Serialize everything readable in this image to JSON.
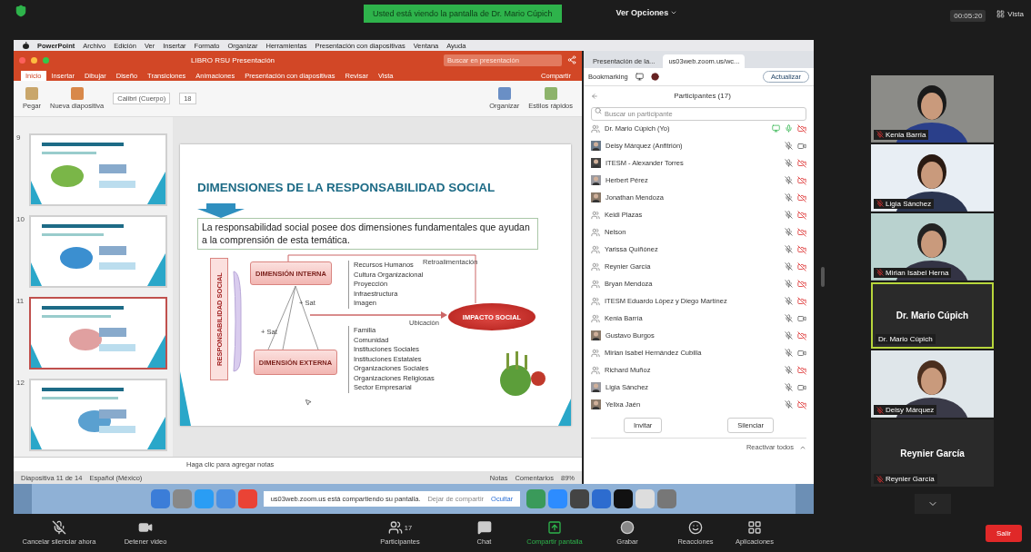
{
  "top_bar": {
    "banner": "Usted está viendo la pantalla de Dr. Mario Cúpich",
    "view_options": "Ver Opciones",
    "timer": "00:05:20",
    "view": "Vista"
  },
  "shared_screen": {
    "menubar": [
      "PowerPoint",
      "Archivo",
      "Edición",
      "Ver",
      "Insertar",
      "Formato",
      "Organizar",
      "Herramientas",
      "Presentación con diapositivas",
      "Ventana",
      "Ayuda"
    ],
    "powerpoint": {
      "title": "LIBRO RSU Presentación",
      "search": {
        "placeholder": "Buscar en presentación"
      },
      "tabs": [
        {
          "label": "Inicio",
          "selected": true
        },
        {
          "label": "Insertar",
          "selected": false
        },
        {
          "label": "Dibujar",
          "selected": false
        },
        {
          "label": "Diseño",
          "selected": false
        },
        {
          "label": "Transiciones",
          "selected": false
        },
        {
          "label": "Animaciones",
          "selected": false
        },
        {
          "label": "Presentación con diapositivas",
          "selected": false
        },
        {
          "label": "Revisar",
          "selected": false
        },
        {
          "label": "Vista",
          "selected": false
        }
      ],
      "share": "Compartir",
      "ribbon": {
        "font": "Calibri (Cuerpo)",
        "size": "18",
        "buttons": [
          "Pegar",
          "Nueva diapositiva",
          "Organizar",
          "Estilos rápidos"
        ]
      },
      "thumbnails": [
        {
          "number": "9",
          "selected": false
        },
        {
          "number": "10",
          "selected": false
        },
        {
          "number": "11",
          "selected": true
        },
        {
          "number": "12",
          "selected": false
        }
      ],
      "slide": {
        "title": "DIMENSIONES DE LA RESPONSABILIDAD SOCIAL",
        "intro": "La responsabilidad social posee dos dimensiones fundamentales que ayudan a la comprensión de esta temática.",
        "axis_label": "RESPONSABILIDAD SOCIAL",
        "internal": "DIMENSIÓN INTERNA",
        "external": "DIMENSIÓN EXTERNA",
        "internal_items": [
          "Recursos Humanos",
          "Cultura Organizacional",
          "Proyección",
          "Infraestructura",
          "Imagen"
        ],
        "external_items": [
          "Familia",
          "Comunidad",
          "Instituciones Sociales",
          "Instituciones Estatales",
          "Organizaciones Sociales",
          "Organizaciones Religiosas",
          "Sector Empresarial"
        ],
        "link_labels": [
          "+ Sat",
          "+ Sat"
        ],
        "feedback": "Retroalimentación",
        "flow": "Ubicación",
        "result": "IMPACTO SOCIAL"
      },
      "notes": "Haga clic para agregar notas",
      "status_bar": {
        "slide": "Diapositiva 11 de 14",
        "language": "Español (México)",
        "notes": "Notas",
        "comments": "Comentarios",
        "zoom": "89%"
      }
    },
    "browser": {
      "tabs": [
        {
          "label": "Presentación de la...",
          "selected": false
        },
        {
          "label": "us03web.zoom.us/wc...",
          "selected": true
        }
      ],
      "bookmark": "Bookmarking",
      "update": "Actualizar",
      "participants": {
        "title": "Participantes (17)",
        "search": {
          "placeholder": "Buscar un participante"
        },
        "items": [
          {
            "name": "Dr. Mario Cúpich (Yo)",
            "photo": false,
            "sharing": true,
            "muted": false,
            "video": false
          },
          {
            "name": "Deisy Márquez (Anfitrión)",
            "photo": true,
            "sharing": false,
            "muted": true,
            "video": true
          },
          {
            "name": "ITESM - Alexander Torres",
            "photo": true,
            "sharing": false,
            "muted": true,
            "video": false
          },
          {
            "name": "Herbert Pérez",
            "photo": true,
            "sharing": false,
            "muted": true,
            "video": false
          },
          {
            "name": "Jonathan Mendoza",
            "photo": true,
            "sharing": false,
            "muted": true,
            "video": false
          },
          {
            "name": "Keidi Plazas",
            "photo": false,
            "sharing": false,
            "muted": true,
            "video": false
          },
          {
            "name": "Nelson",
            "photo": false,
            "sharing": false,
            "muted": true,
            "video": false
          },
          {
            "name": "Yarissa Quiñónez",
            "photo": false,
            "sharing": false,
            "muted": true,
            "video": false
          },
          {
            "name": "Reynier García",
            "photo": false,
            "sharing": false,
            "muted": true,
            "video": false
          },
          {
            "name": "Bryan Mendoza",
            "photo": false,
            "sharing": false,
            "muted": true,
            "video": false
          },
          {
            "name": "ITESM Eduardo López y Diego Martínez",
            "photo": false,
            "sharing": false,
            "muted": true,
            "video": false
          },
          {
            "name": "Kenia Barría",
            "photo": false,
            "sharing": false,
            "muted": true,
            "video": true
          },
          {
            "name": "Gustavo Burgos",
            "photo": true,
            "sharing": false,
            "muted": true,
            "video": false
          },
          {
            "name": "Mirian Isabel Hernández Cubilla",
            "photo": false,
            "sharing": false,
            "muted": true,
            "video": true
          },
          {
            "name": "Richard Muñoz",
            "photo": false,
            "sharing": false,
            "muted": true,
            "video": false
          },
          {
            "name": "Ligia Sánchez",
            "photo": true,
            "sharing": false,
            "muted": true,
            "video": true
          },
          {
            "name": "Yelixa Jaén",
            "photo": true,
            "sharing": false,
            "muted": true,
            "video": false
          }
        ],
        "buttons": [
          "Invitar",
          "Silenciar"
        ],
        "footer": "Reactivar todos"
      }
    },
    "dock": {
      "notice": "us03web.zoom.us está compartiendo su pantalla.",
      "stop": "Dejar de compartir",
      "hide": "Ocultar"
    }
  },
  "gallery": [
    {
      "name": "Kenia Barría",
      "video": true,
      "muted": true,
      "speaking": false
    },
    {
      "name": "Ligia Sánchez",
      "video": true,
      "muted": true,
      "speaking": false
    },
    {
      "name": "Mirian Isabel Herna",
      "video": true,
      "muted": true,
      "speaking": false
    },
    {
      "name": "Dr. Mario Cúpich",
      "display_name": "Dr. Mario Cúpich",
      "video": false,
      "muted": false,
      "speaking": true
    },
    {
      "name": "Deisy Márquez",
      "video": true,
      "muted": true,
      "speaking": false
    },
    {
      "name": "Reynier García",
      "display_name": "Reynier García",
      "video": false,
      "muted": true,
      "speaking": false
    }
  ],
  "toolbar": {
    "items": [
      {
        "kind": "mute",
        "label": "Cancelar silenciar ahora"
      },
      {
        "kind": "video",
        "label": "Detener video"
      },
      {
        "kind": "participants",
        "label": "Participantes",
        "count": "17"
      },
      {
        "kind": "chat",
        "label": "Chat"
      },
      {
        "kind": "share",
        "label": "Compartir pantalla"
      },
      {
        "kind": "record",
        "label": "Grabar"
      },
      {
        "kind": "reactions",
        "label": "Reacciones"
      },
      {
        "kind": "apps",
        "label": "Aplicaciones"
      }
    ],
    "leave": "Salir"
  }
}
